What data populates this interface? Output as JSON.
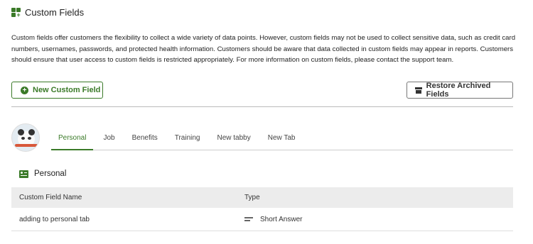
{
  "header": {
    "title": "Custom Fields",
    "icon": "custom-fields-icon"
  },
  "description": "Custom fields offer customers the flexibility to collect a wide variety of data points. However, custom fields may not be used to collect sensitive data, such as credit card numbers, usernames, passwords, and protected health information. Customers should be aware that data collected in custom fields may appear in reports. Customers should ensure that user access to custom fields is restricted appropriately. For more information on custom fields, please contact the support team.",
  "actions": {
    "new_label": "New Custom Field",
    "restore_label": "Restore Archived Fields"
  },
  "tabs": [
    {
      "label": "Personal",
      "active": true
    },
    {
      "label": "Job",
      "active": false
    },
    {
      "label": "Benefits",
      "active": false
    },
    {
      "label": "Training",
      "active": false
    },
    {
      "label": "New tabby",
      "active": false
    },
    {
      "label": "New Tab",
      "active": false
    }
  ],
  "section": {
    "title": "Personal",
    "icon": "id-card-icon"
  },
  "table": {
    "columns": [
      "Custom Field Name",
      "Type"
    ],
    "rows": [
      {
        "name": "adding to personal tab",
        "type": "Short Answer",
        "type_icon": "short-answer-icon"
      }
    ]
  },
  "colors": {
    "accent": "#3a7a28",
    "header_bg": "#ececec"
  }
}
